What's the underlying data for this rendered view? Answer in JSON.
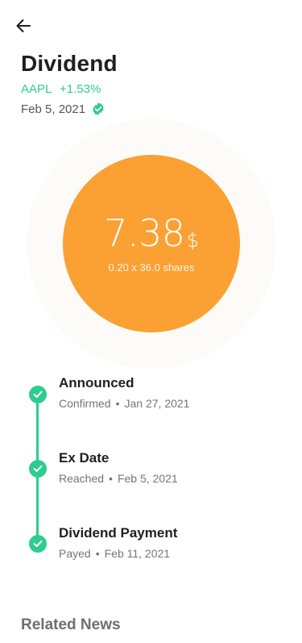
{
  "header": {
    "back_icon": "arrow-left-icon",
    "title": "Dividend",
    "ticker": "AAPL",
    "change": "+1.53%",
    "date": "Feb 5, 2021",
    "verified_icon": "check-badge-icon"
  },
  "payout": {
    "amount": "7.38",
    "currency": "$",
    "detail": "0.20 x 36.0 shares"
  },
  "timeline": [
    {
      "title": "Announced",
      "status": "Confirmed",
      "separator": "•",
      "date": "Jan 27, 2021"
    },
    {
      "title": "Ex Date",
      "status": "Reached",
      "separator": "•",
      "date": "Feb 5, 2021"
    },
    {
      "title": "Dividend Payment",
      "status": "Payed",
      "separator": "•",
      "date": "Feb 11, 2021"
    }
  ],
  "section": {
    "related_news": "Related News"
  },
  "colors": {
    "accent_green": "#2ecc8f",
    "coin_orange": "#fba033"
  }
}
